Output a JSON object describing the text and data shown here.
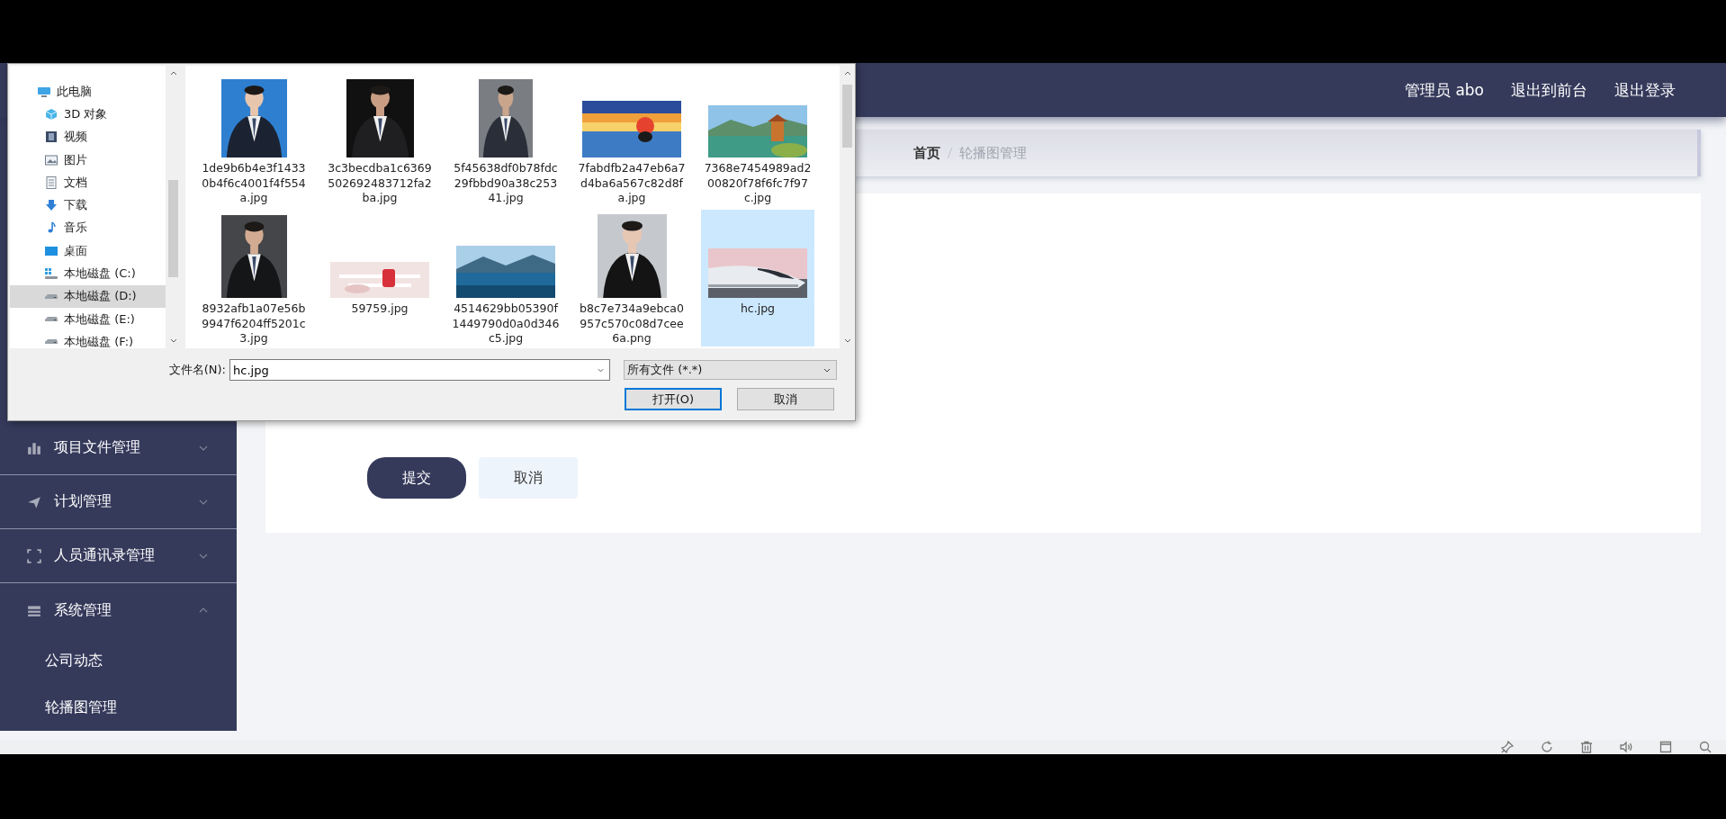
{
  "header": {
    "user": "管理员 abo",
    "links": [
      "退出到前台",
      "退出登录"
    ]
  },
  "breadcrumb": [
    {
      "label": "首页",
      "current": false
    },
    {
      "label": "轮播图管理",
      "current": true
    }
  ],
  "sidebar": {
    "items": [
      {
        "label": "项目文件管理",
        "expanded": false
      },
      {
        "label": "计划管理",
        "expanded": false
      },
      {
        "label": "人员通讯录管理",
        "expanded": false
      },
      {
        "label": "系统管理",
        "expanded": true,
        "children": [
          {
            "label": "公司动态"
          },
          {
            "label": "轮播图管理"
          }
        ]
      }
    ]
  },
  "form_buttons": [
    "提交",
    "取消"
  ],
  "file_dialog": {
    "nav": [
      {
        "label": "此电脑",
        "selected": false,
        "children": [
          {
            "label": "3D 对象",
            "selected": false
          },
          {
            "label": "视频",
            "selected": false
          },
          {
            "label": "图片",
            "selected": false
          },
          {
            "label": "文档",
            "selected": false
          },
          {
            "label": "下载",
            "selected": false
          },
          {
            "label": "音乐",
            "selected": false
          },
          {
            "label": "桌面",
            "selected": false
          },
          {
            "label": "本地磁盘 (C:)",
            "selected": false
          },
          {
            "label": "本地磁盘 (D:)",
            "selected": true
          },
          {
            "label": "本地磁盘 (E:)",
            "selected": false
          },
          {
            "label": "本地磁盘 (F:)",
            "selected": false
          }
        ]
      }
    ],
    "files": [
      {
        "name": "1de9b6b4e3f14330b4f6c4001f4f554a.jpg",
        "selected": false
      },
      {
        "name": "3c3becdba1c6369502692483712fa2ba.jpg",
        "selected": false
      },
      {
        "name": "5f45638df0b78fdc29fbbd90a38c25341.jpg",
        "selected": false
      },
      {
        "name": "7fabdfb2a47eb6a7d4ba6a567c82d8fa.jpg",
        "selected": false
      },
      {
        "name": "7368e7454989ad200820f78f6fc7f97c.jpg",
        "selected": false
      },
      {
        "name": "8932afb1a07e56b9947f6204ff5201c3.jpg",
        "selected": false
      },
      {
        "name": "59759.jpg",
        "selected": false
      },
      {
        "name": "4514629bb05390f1449790d0a0d346c5.jpg",
        "selected": false
      },
      {
        "name": "b8c7e734a9ebca0957c570c08d7cee6a.png",
        "selected": false
      },
      {
        "name": "hc.jpg",
        "selected": true
      }
    ],
    "filename": {
      "label": "文件名(N):",
      "value": "hc.jpg"
    },
    "filter": {
      "value": "所有文件 (*.*)"
    },
    "buttons": [
      "打开(O)",
      "取消"
    ]
  }
}
